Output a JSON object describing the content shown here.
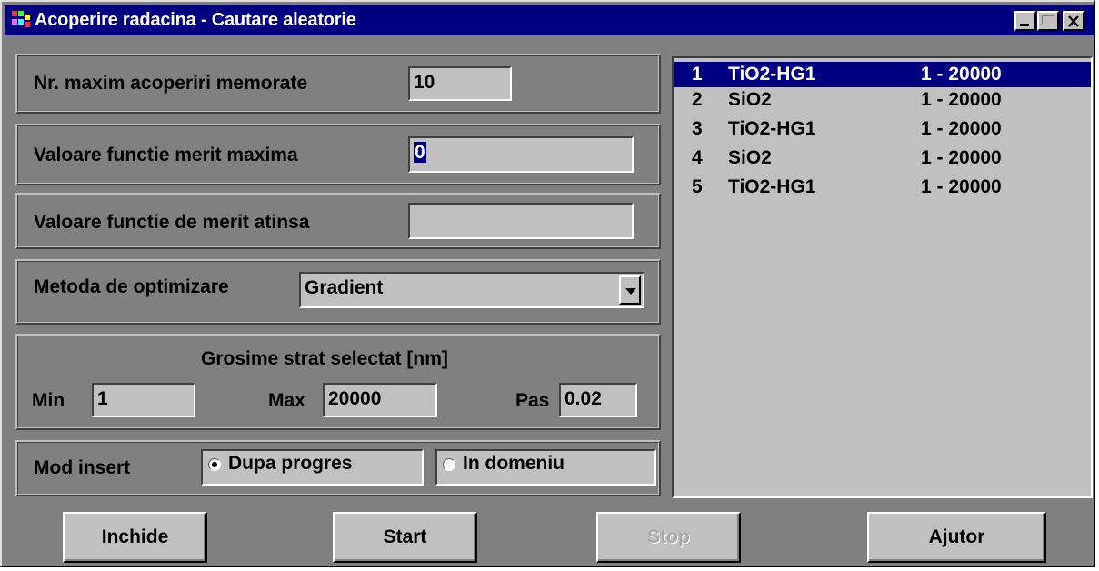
{
  "window": {
    "title": "Acoperire radacina - Cautare aleatorie",
    "controls": [
      "minimize-icon",
      "maximize-icon",
      "close-icon"
    ]
  },
  "max_coatings": {
    "label": "Nr. maxim acoperiri memorate",
    "value": "10"
  },
  "merit_max": {
    "label": "Valoare functie merit maxima",
    "value": "0"
  },
  "merit_reached": {
    "label": "Valoare functie de merit atinsa",
    "value": ""
  },
  "method": {
    "label": "Metoda de optimizare",
    "selected": "Gradient"
  },
  "thickness": {
    "title": "Grosime strat selectat [nm]",
    "min_label": "Min",
    "min_value": "1",
    "max_label": "Max",
    "max_value": "20000",
    "step_label": "Pas",
    "step_value": "0.02"
  },
  "insert_mode": {
    "label": "Mod insert",
    "options": [
      {
        "label": "Dupa progres",
        "selected": true
      },
      {
        "label": "In domeniu",
        "selected": false
      }
    ]
  },
  "layers": [
    {
      "index": "1",
      "material": "TiO2-HG1",
      "range": "1 - 20000",
      "selected": true
    },
    {
      "index": "2",
      "material": "SiO2",
      "range": "1 - 20000",
      "selected": false
    },
    {
      "index": "3",
      "material": "TiO2-HG1",
      "range": "1 - 20000",
      "selected": false
    },
    {
      "index": "4",
      "material": "SiO2",
      "range": "1 - 20000",
      "selected": false
    },
    {
      "index": "5",
      "material": "TiO2-HG1",
      "range": "1 - 20000",
      "selected": false
    }
  ],
  "buttons": {
    "close": "Inchide",
    "start": "Start",
    "stop": "Stop",
    "help": "Ajutor",
    "stop_enabled": false
  },
  "colors": {
    "titlebar": "#000080",
    "face": "#c0c0c0",
    "background": "#808080",
    "selection": "#000080"
  }
}
